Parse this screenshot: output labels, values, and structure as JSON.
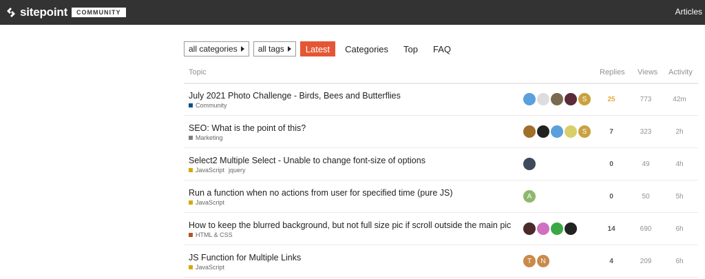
{
  "header": {
    "logo_text": "sitepoint",
    "logo_badge": "COMMUNITY",
    "articles_label": "Articles",
    "colors": {
      "bar": "#333333",
      "accent": "#e45735"
    }
  },
  "nav": {
    "categories_dropdown": "all categories",
    "tags_dropdown": "all tags",
    "tabs": [
      {
        "label": "Latest",
        "active": true
      },
      {
        "label": "Categories",
        "active": false
      },
      {
        "label": "Top",
        "active": false
      },
      {
        "label": "FAQ",
        "active": false
      }
    ]
  },
  "table": {
    "headers": {
      "topic": "Topic",
      "replies": "Replies",
      "views": "Views",
      "activity": "Activity"
    },
    "rows": [
      {
        "title": "July 2021 Photo Challenge - Birds, Bees and Butterflies",
        "category": "Community",
        "category_color": "#0e4f8a",
        "tags": [],
        "avatars": [
          "#5aa0dc",
          "#ddd",
          "#7b6a4f",
          "#5b2b3a",
          "#c9a13f"
        ],
        "avatar_letters": [
          "",
          "",
          "",
          "",
          "S"
        ],
        "replies": "25",
        "views": "773",
        "activity": "42m",
        "hot": true
      },
      {
        "title": "SEO: What is the point of this?",
        "category": "Marketing",
        "category_color": "#808080",
        "tags": [],
        "avatars": [
          "#a0702a",
          "#222",
          "#5aa0dc",
          "#d9cf6a",
          "#c9a13f"
        ],
        "avatar_letters": [
          "",
          "",
          "",
          "",
          "S"
        ],
        "replies": "7",
        "views": "323",
        "activity": "2h",
        "hot": false
      },
      {
        "title": "Select2 Multiple Select - Unable to change font-size of options",
        "category": "JavaScript",
        "category_color": "#d6a800",
        "tags": [
          "jquery"
        ],
        "avatars": [
          "#3e4a5c"
        ],
        "avatar_letters": [
          ""
        ],
        "replies": "0",
        "views": "49",
        "activity": "4h",
        "hot": false
      },
      {
        "title": "Run a function when no actions from user for specified time (pure JS)",
        "category": "JavaScript",
        "category_color": "#d6a800",
        "tags": [],
        "avatars": [
          "#8fb86e"
        ],
        "avatar_letters": [
          "A"
        ],
        "replies": "0",
        "views": "50",
        "activity": "5h",
        "hot": false
      },
      {
        "title": "How to keep the blurred background, but not full size pic if scroll outside the main pic",
        "category": "HTML & CSS",
        "category_color": "#b3561f",
        "tags": [],
        "avatars": [
          "#4a2a2a",
          "#d070c0",
          "#3aa845",
          "#222"
        ],
        "avatar_letters": [
          "",
          "",
          "",
          ""
        ],
        "replies": "14",
        "views": "690",
        "activity": "6h",
        "hot": false
      },
      {
        "title": "JS Function for Multiple Links",
        "category": "JavaScript",
        "category_color": "#d6a800",
        "tags": [],
        "avatars": [
          "#c98a4a",
          "#c98a4a"
        ],
        "avatar_letters": [
          "T",
          "N"
        ],
        "replies": "4",
        "views": "209",
        "activity": "6h",
        "hot": false
      }
    ]
  }
}
